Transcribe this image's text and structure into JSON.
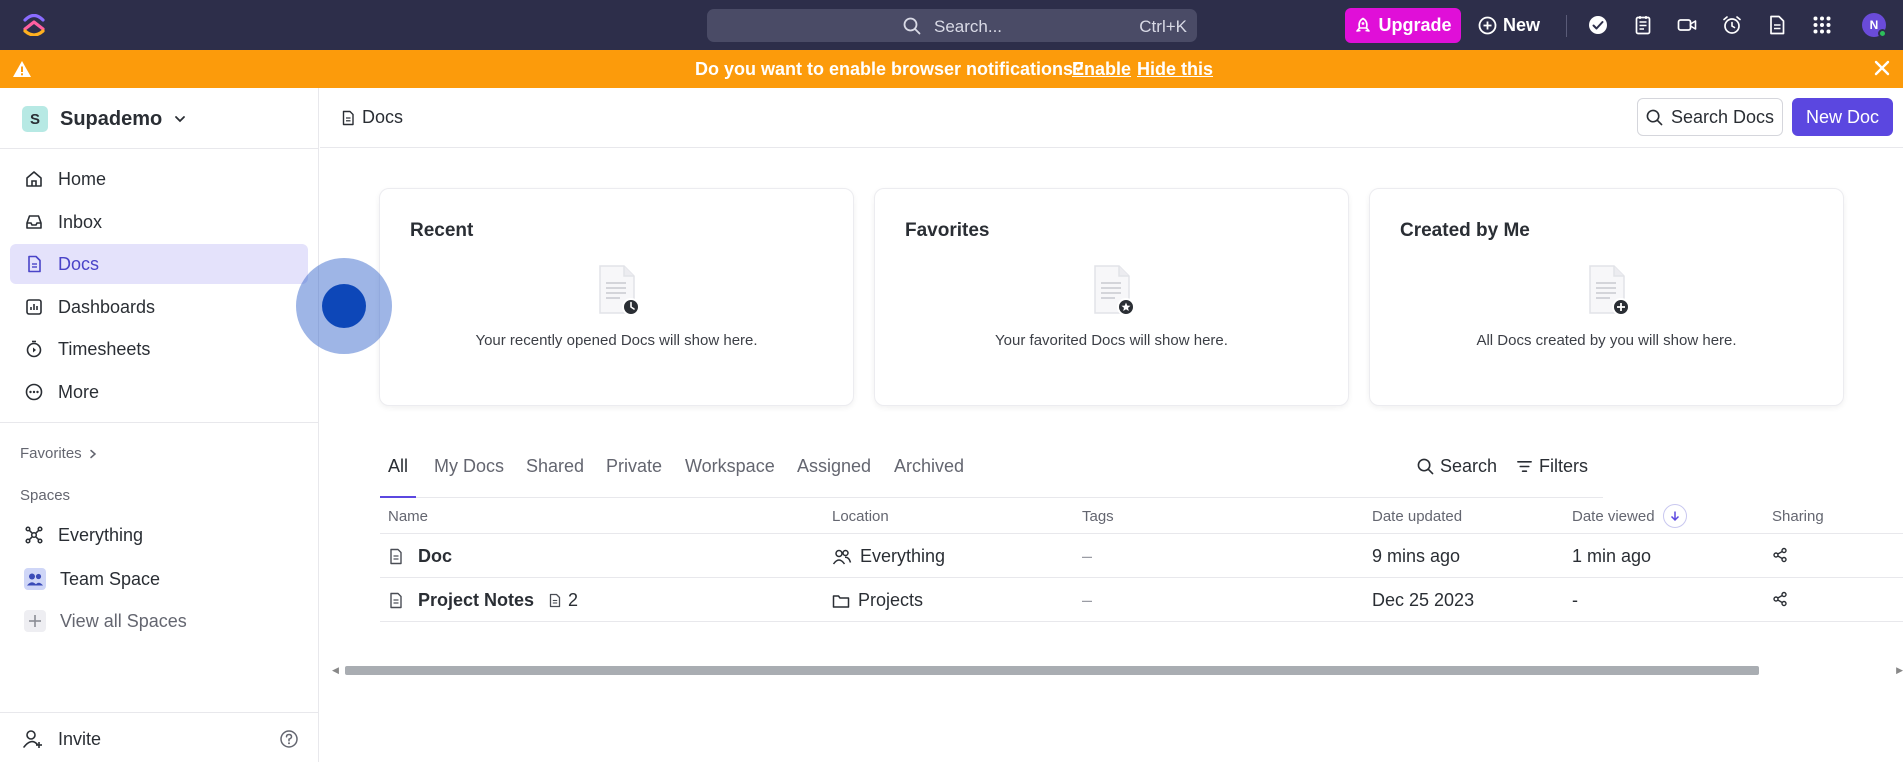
{
  "topbar": {
    "search_placeholder": "Search...",
    "search_shortcut": "Ctrl+K",
    "upgrade_label": "Upgrade",
    "new_label": "New",
    "avatar_initial": "N",
    "icons": [
      "check-circle-icon",
      "notepad-icon",
      "video-icon",
      "alarm-icon",
      "doc-icon",
      "apps-grid-icon"
    ]
  },
  "banner": {
    "message": "Do you want to enable browser notifications?",
    "enable_label": "Enable",
    "hide_label": "Hide this",
    "bg_color": "#fc9b0b"
  },
  "sidebar": {
    "workspace_initial": "S",
    "workspace_name": "Supademo",
    "nav": [
      {
        "label": "Home",
        "icon": "home-icon"
      },
      {
        "label": "Inbox",
        "icon": "inbox-icon"
      },
      {
        "label": "Docs",
        "icon": "doc-icon",
        "active": true
      },
      {
        "label": "Dashboards",
        "icon": "dashboard-icon"
      },
      {
        "label": "Timesheets",
        "icon": "stopwatch-icon"
      },
      {
        "label": "More",
        "icon": "more-icon"
      }
    ],
    "favorites_label": "Favorites",
    "spaces_label": "Spaces",
    "spaces": [
      {
        "label": "Everything",
        "icon": "everything-icon"
      },
      {
        "label": "Team Space",
        "icon": "team-icon"
      },
      {
        "label": "View all Spaces",
        "icon": "plus-icon"
      }
    ],
    "invite_label": "Invite"
  },
  "header": {
    "breadcrumb": "Docs",
    "search_docs_label": "Search Docs",
    "new_doc_label": "New Doc",
    "accent_color": "#5b47e0"
  },
  "cards": [
    {
      "title": "Recent",
      "text": "Your recently opened Docs will show here.",
      "badge_icon": "clock-icon"
    },
    {
      "title": "Favorites",
      "text": "Your favorited Docs will show here.",
      "badge_icon": "star-icon"
    },
    {
      "title": "Created by Me",
      "text": "All Docs created by you will show here.",
      "badge_icon": "plus-icon"
    }
  ],
  "tabs": [
    "All",
    "My Docs",
    "Shared",
    "Private",
    "Workspace",
    "Assigned",
    "Archived"
  ],
  "tab_tools": {
    "search_label": "Search",
    "filters_label": "Filters"
  },
  "table": {
    "columns": [
      "Name",
      "Location",
      "Tags",
      "Date updated",
      "Date viewed",
      "Sharing"
    ],
    "rows": [
      {
        "name": "Doc",
        "subcount": "",
        "location": "Everything",
        "location_icon": "people-icon",
        "tags": "–",
        "updated": "9 mins ago",
        "viewed": "1 min ago"
      },
      {
        "name": "Project Notes",
        "subcount": "2",
        "location": "Projects",
        "location_icon": "folder-icon",
        "tags": "–",
        "updated": "Dec 25 2023",
        "viewed": "-"
      }
    ]
  }
}
